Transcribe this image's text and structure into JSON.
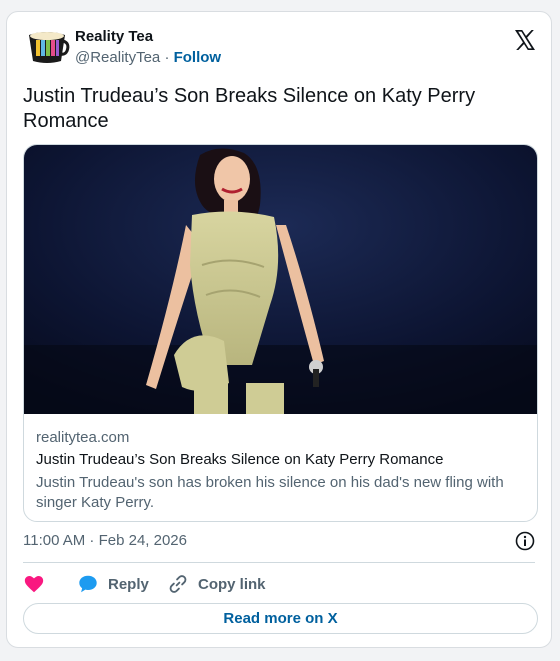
{
  "author": {
    "name": "Reality Tea",
    "handle": "@RealityTea",
    "separator": "·",
    "follow_label": "Follow"
  },
  "tweet": {
    "text": "Justin Trudeau’s Son Breaks Silence on Katy Perry Romance"
  },
  "link_card": {
    "domain": "realitytea.com",
    "title": "Justin Trudeau’s Son Breaks Silence on Katy Perry Romance",
    "description": "Justin Trudeau's son has broken his silence on his dad's new fling with singer Katy Perry."
  },
  "meta": {
    "timestamp": "11:00 AM · Feb 24, 2026"
  },
  "actions": {
    "like_label": "",
    "reply_label": "Reply",
    "copy_label": "Copy link"
  },
  "footer": {
    "read_more_label": "Read more on X"
  },
  "colors": {
    "link": "#00609e",
    "like": "#f91880",
    "reply": "#1d9bf0",
    "muted": "#536471"
  },
  "icons": [
    "x-logo-icon",
    "info-icon",
    "heart-icon",
    "reply-bubble-icon",
    "link-icon"
  ]
}
